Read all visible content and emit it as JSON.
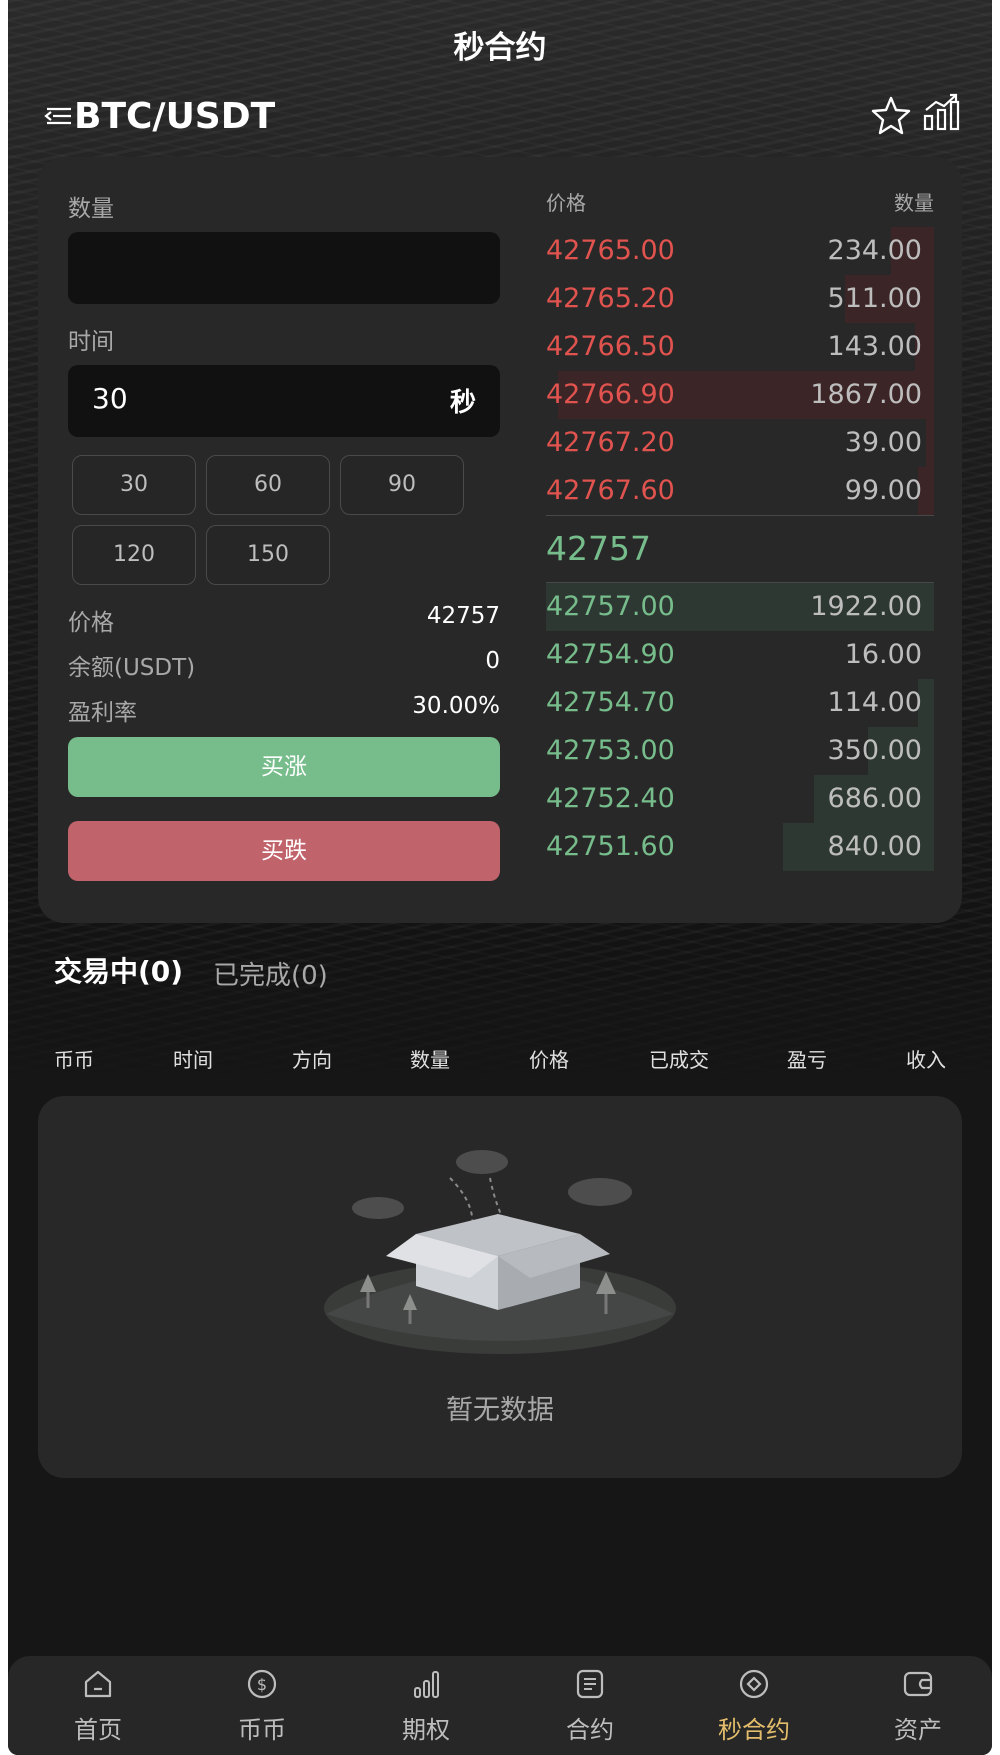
{
  "header": {
    "title": "秒合约",
    "pair": "BTC/USDT"
  },
  "form": {
    "qty_label": "数量",
    "qty_value": "",
    "time_label": "时间",
    "time_value": "30",
    "time_unit": "秒",
    "presets": [
      "30",
      "60",
      "90",
      "120",
      "150"
    ],
    "price_label": "价格",
    "price_value": "42757",
    "balance_label": "余额(USDT)",
    "balance_value": "0",
    "profit_label": "盈利率",
    "profit_value": "30.00%",
    "buy_up_label": "买涨",
    "buy_down_label": "买跌"
  },
  "orderbook": {
    "price_header": "价格",
    "qty_header": "数量",
    "last_price": "42757",
    "asks": [
      {
        "price": "42765.00",
        "qty": "234.00",
        "depth": 0.11
      },
      {
        "price": "42765.20",
        "qty": "511.00",
        "depth": 0.23
      },
      {
        "price": "42766.50",
        "qty": "143.00",
        "depth": 0.05
      },
      {
        "price": "42766.90",
        "qty": "1867.00",
        "depth": 0.97
      },
      {
        "price": "42767.20",
        "qty": "39.00",
        "depth": 0.02
      },
      {
        "price": "42767.60",
        "qty": "99.00",
        "depth": 0.04
      }
    ],
    "bids": [
      {
        "price": "42757.00",
        "qty": "1922.00",
        "depth": 1.0
      },
      {
        "price": "42754.90",
        "qty": "16.00",
        "depth": 0.0
      },
      {
        "price": "42754.70",
        "qty": "114.00",
        "depth": 0.04
      },
      {
        "price": "42753.00",
        "qty": "350.00",
        "depth": 0.17
      },
      {
        "price": "42752.40",
        "qty": "686.00",
        "depth": 0.31
      },
      {
        "price": "42751.60",
        "qty": "840.00",
        "depth": 0.39
      }
    ]
  },
  "tabs": {
    "active": "交易中(0)",
    "done": "已完成(0)"
  },
  "columns": [
    "币币",
    "时间",
    "方向",
    "数量",
    "价格",
    "已成交",
    "盈亏",
    "收入"
  ],
  "empty_text": "暂无数据",
  "nav": [
    {
      "label": "首页",
      "icon": "home-icon"
    },
    {
      "label": "币币",
      "icon": "coin-icon"
    },
    {
      "label": "期权",
      "icon": "bar-chart-icon"
    },
    {
      "label": "合约",
      "icon": "document-icon"
    },
    {
      "label": "秒合约",
      "icon": "diamond-icon",
      "active": true
    },
    {
      "label": "资产",
      "icon": "wallet-icon"
    }
  ],
  "colors": {
    "up": "#77bd8c",
    "down": "#c0636b",
    "ask_text": "#e0534f",
    "nav_active": "#e3bd6b"
  }
}
